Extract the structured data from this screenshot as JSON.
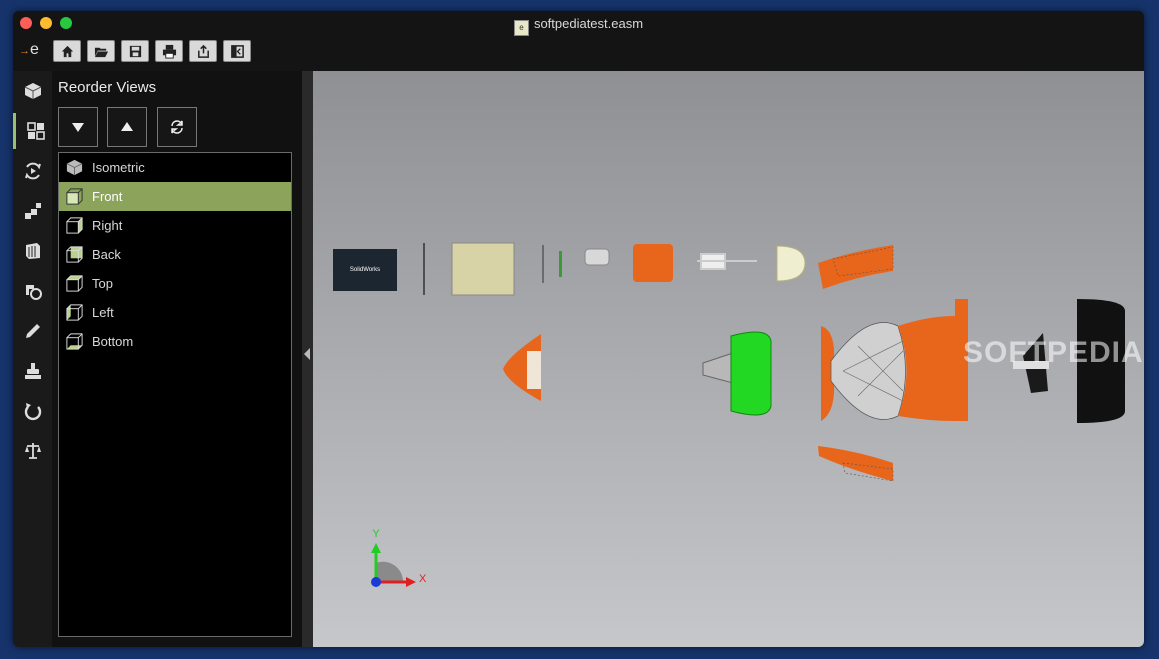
{
  "window": {
    "title": "softpediatest.easm"
  },
  "app": {
    "logo_text": "e",
    "logo_arrow": "→"
  },
  "toolbar": {
    "buttons": [
      {
        "name": "home-button",
        "icon": "home-icon"
      },
      {
        "name": "open-button",
        "icon": "folder-open-icon"
      },
      {
        "name": "save-button",
        "icon": "save-icon"
      },
      {
        "name": "print-button",
        "icon": "print-icon"
      },
      {
        "name": "share-button",
        "icon": "share-icon"
      },
      {
        "name": "toggle-panel-button",
        "icon": "panel-toggle-icon"
      }
    ]
  },
  "sidebar": {
    "tools": [
      "views-cube-icon",
      "reorder-views-icon",
      "animation-icon",
      "explode-icon",
      "components-icon",
      "mark-up-icon",
      "pencil-icon",
      "stamp-icon",
      "rotate-icon",
      "measure-balance-icon"
    ]
  },
  "panel": {
    "title": "Reorder Views",
    "buttons": [
      "move-down-icon",
      "move-up-icon",
      "refresh-icon"
    ],
    "views": [
      {
        "label": "Isometric",
        "selected": false
      },
      {
        "label": "Front",
        "selected": true
      },
      {
        "label": "Right",
        "selected": false
      },
      {
        "label": "Back",
        "selected": false
      },
      {
        "label": "Top",
        "selected": false
      },
      {
        "label": "Left",
        "selected": false
      },
      {
        "label": "Bottom",
        "selected": false
      }
    ]
  },
  "viewport": {
    "triad": {
      "x_label": "X",
      "y_label": "Y"
    },
    "watermark": "SOFTPEDIA",
    "part_label": "SolidWorks"
  },
  "colors": {
    "accent": "#8ca35c",
    "part_orange": "#e8661c",
    "part_green": "#22d822"
  }
}
